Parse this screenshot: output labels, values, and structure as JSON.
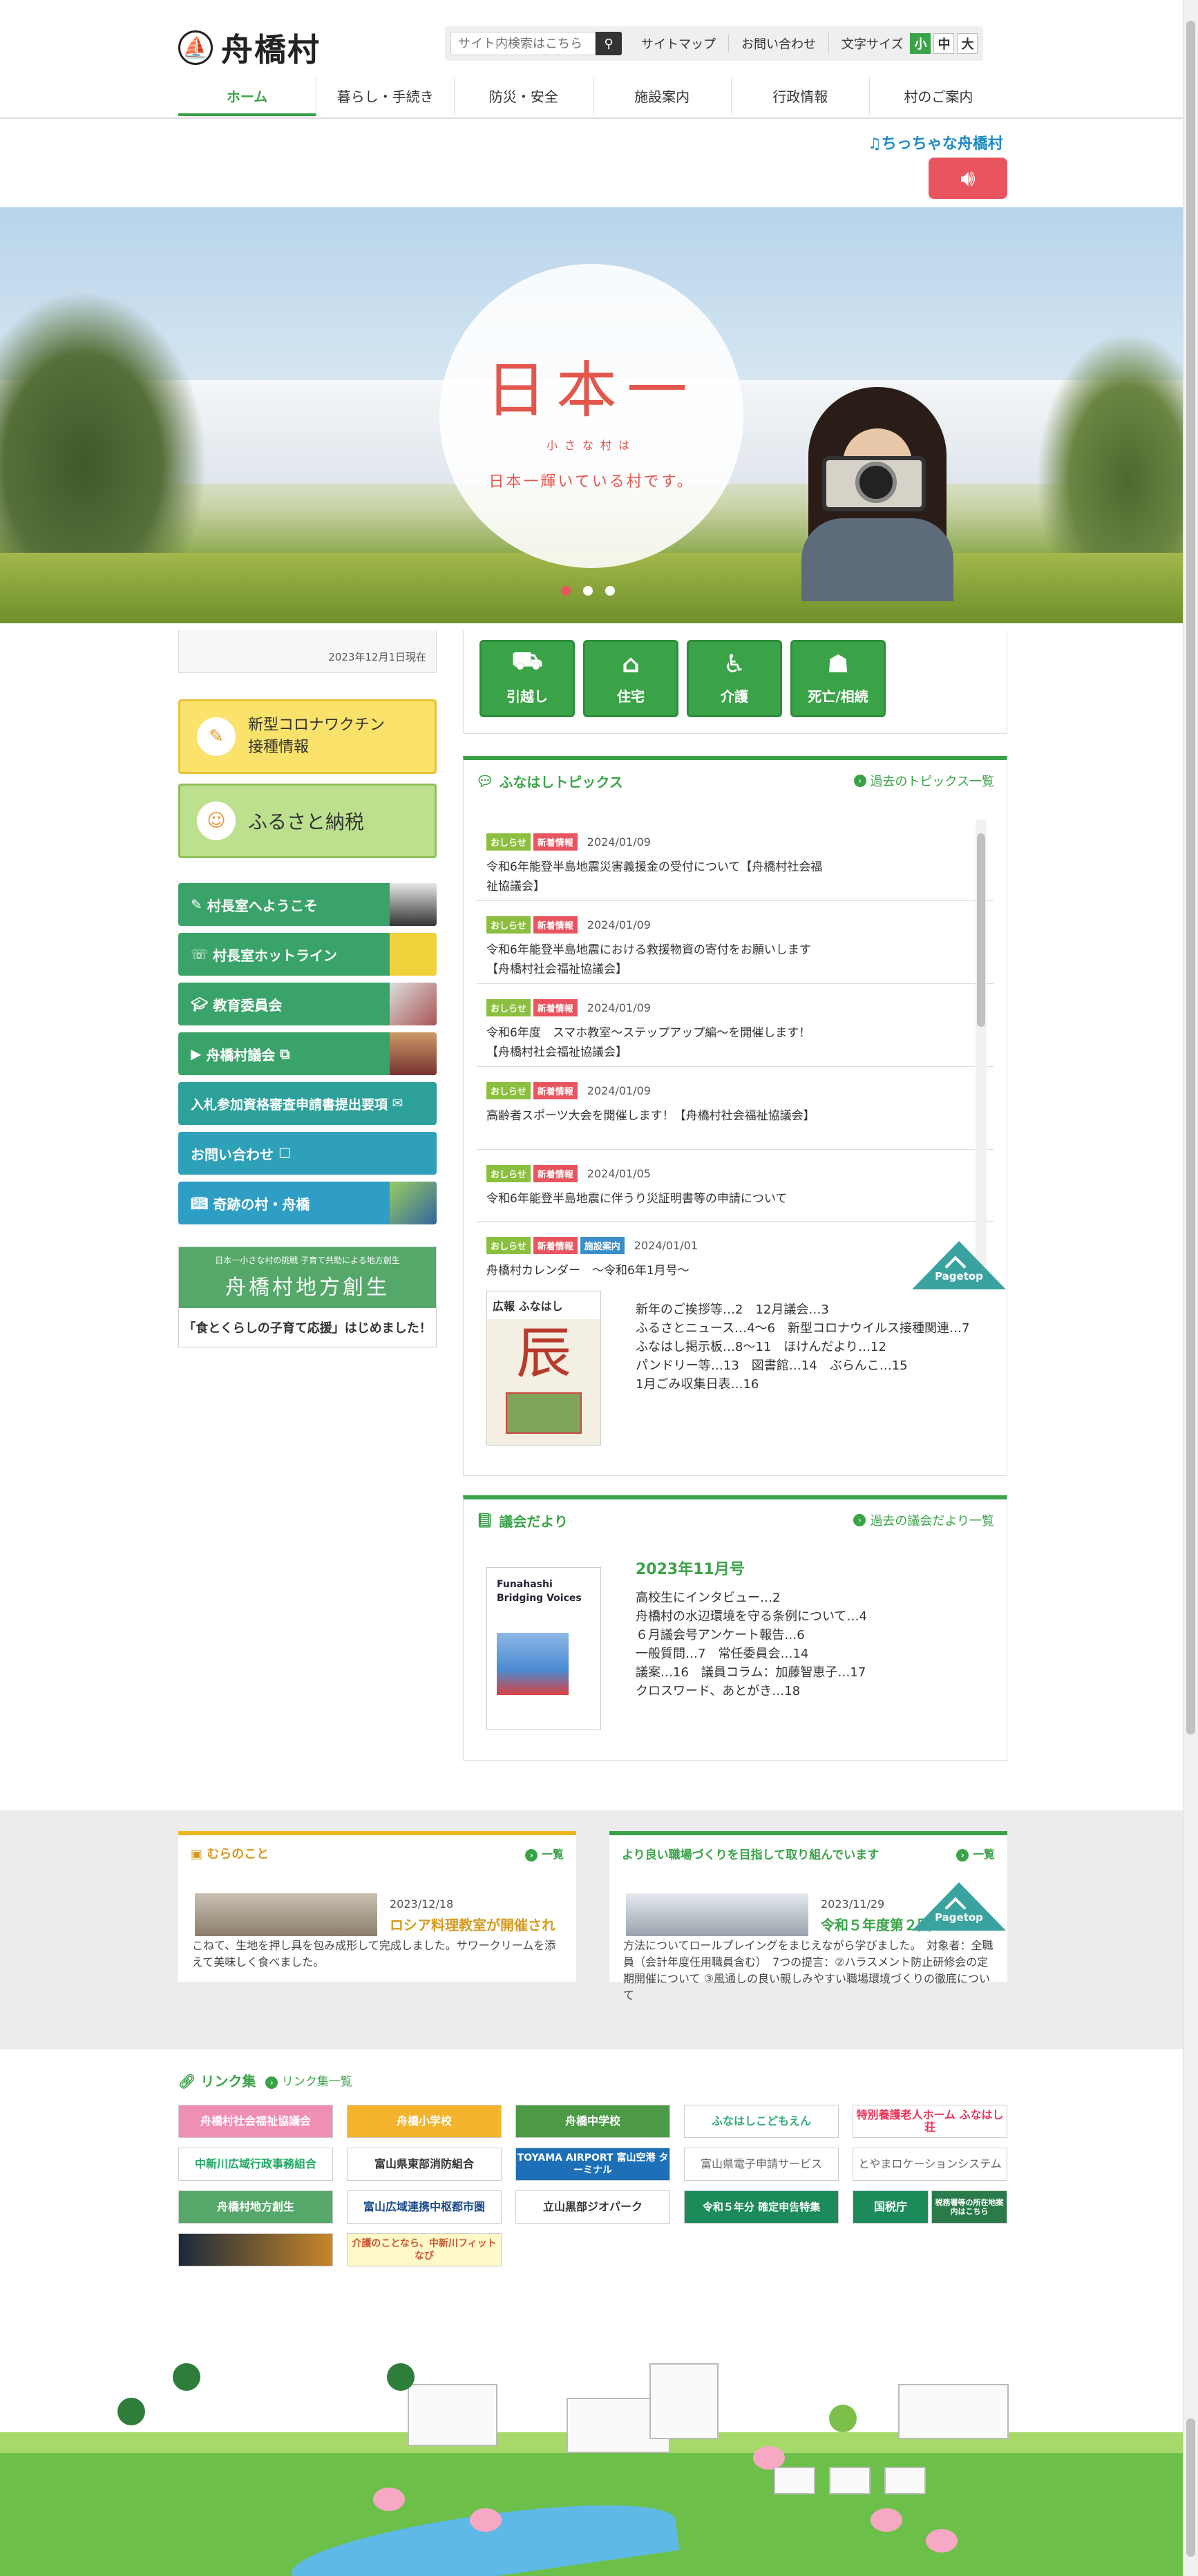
{
  "header": {
    "logo_text": "舟橋村",
    "search_placeholder": "サイト内検索はこちら",
    "sitemap": "サイトマップ",
    "contact": "お問い合わせ",
    "font_size_label": "文字サイズ",
    "font_small": "小",
    "font_mid": "中",
    "font_large": "大"
  },
  "nav": [
    "ホーム",
    "暮らし・手続き",
    "防災・安全",
    "施設案内",
    "行政情報",
    "村のご案内"
  ],
  "chiichana": "ちっちゃな舟橋村",
  "hero": {
    "big": "日本一",
    "small": "小さな村は",
    "lead": "日本一輝いている村です。"
  },
  "side": {
    "date_note": "2023年12月1日現在",
    "corona": [
      "新型コロナワクチン",
      "接種情報"
    ],
    "furusato": "ふるさと納税",
    "buttons": [
      "村長室へようこそ",
      "村長室ホットライン",
      "教育委員会",
      "舟橋村議会",
      "入札参加資格審査申請書提出要項",
      "お問い合わせ",
      "奇跡の村・舟橋"
    ],
    "child": {
      "small": "日本一小さな村の挑戦 子育て共助による地方創生",
      "logo": "舟橋村地方創生",
      "bottom": "「食とくらしの子育て応援」はじめました！"
    }
  },
  "life_buttons": [
    "引越し",
    "住宅",
    "介護",
    "死亡/相続"
  ],
  "topics": {
    "title": "ふなはしトピックス",
    "more": "過去のトピックス一覧",
    "items": [
      {
        "tags": [
          "おしらせ",
          "新着情報"
        ],
        "date": "2024/01/09",
        "text": "令和6年能登半島地震災害義援金の受付について【舟橋村社会福祉協議会】"
      },
      {
        "tags": [
          "おしらせ",
          "新着情報"
        ],
        "date": "2024/01/09",
        "text": "令和6年能登半島地震における救援物資の寄付をお願いします【舟橋村社会福祉協議会】"
      },
      {
        "tags": [
          "おしらせ",
          "新着情報"
        ],
        "date": "2024/01/09",
        "text": "令和6年度　スマホ教室～ステップアップ編～を開催します！【舟橋村社会福祉協議会】"
      },
      {
        "tags": [
          "おしらせ",
          "新着情報"
        ],
        "date": "2024/01/09",
        "text": "高齢者スポーツ大会を開催します！【舟橋村社会福祉協議会】"
      },
      {
        "tags": [
          "おしらせ",
          "新着情報"
        ],
        "date": "2024/01/05",
        "text": "令和6年能登半島地震に伴うり災証明書等の申請について"
      },
      {
        "tags": [
          "おしらせ",
          "新着情報",
          "施設案内"
        ],
        "date": "2024/01/01",
        "text": "舟橋村カレンダー　～令和6年1月号～"
      }
    ]
  },
  "pagetop": "Pagetop",
  "kouhou": {
    "cover_head": "広報 ふなはし",
    "cover_kanji": "辰",
    "lines": [
      "新年のご挨拶等…2　12月議会…3",
      "ふるさとニュース…4～6　新型コロナウイルス接種関連…7",
      "ふなはし掲示板…8～11　ほけんだより…12",
      "パンドリー等…13　図書館…14　ぶらんこ…15",
      "1月ごみ収集日表…16"
    ]
  },
  "gikai": {
    "title": "議会だより",
    "more": "過去の議会だより一覧",
    "cover_title": "Funahashi Bridging Voices",
    "issue": "2023年11月号",
    "lines": [
      "高校生にインタビュー…2",
      "舟橋村の水辺環境を守る条例について…4",
      "６月議会号アンケート報告…6",
      "一般質問…7　常任委員会…14",
      "議案…16　議員コラム：加藤智恵子…17",
      "クロスワード、あとがき…18"
    ]
  },
  "cards": [
    {
      "title": "むらのこと",
      "more": "一覧",
      "date": "2023/12/18",
      "headline": "ロシア料理教室が開催され",
      "body": "こねて、生地を押し具を包み成形して完成しました。サワークリームを添えて美味しく食べました。"
    },
    {
      "title": "より良い職場づくりを目指して取り組んでいます",
      "more": "一覧",
      "date": "2023/11/29",
      "headline": "令和５年度第２回",
      "body": "方法についてロールプレイングをまじえながら学びました。　対象者：全職員（会計年度任用職員含む）　7つの提言：②ハラスメント防止研修会の定期開催について ③風通しの良い親しみやすい職場環境づくりの徹底について"
    }
  ],
  "links": {
    "title": "リンク集",
    "more": "リンク集一覧",
    "banners": [
      "舟橋村社会福祉協議会",
      "舟橋小学校",
      "舟橋中学校",
      "ふなはしこどもえん",
      "特別養護老人ホーム ふなはし荘",
      "中新川広域行政事務組合",
      "富山県東部消防組合",
      "TOYAMA AIRPORT 富山空港 ターミナル",
      "富山県電子申請サービス",
      "とやまロケーションシステム",
      "舟橋村地方創生",
      "富山広域連携中枢都市圏",
      "立山黒部ジオパーク",
      "令和５年分 確定申告特集",
      "国税庁",
      "税務署等の所在地案内はこちら",
      "介護のことなら、中新川フィットなび"
    ]
  }
}
